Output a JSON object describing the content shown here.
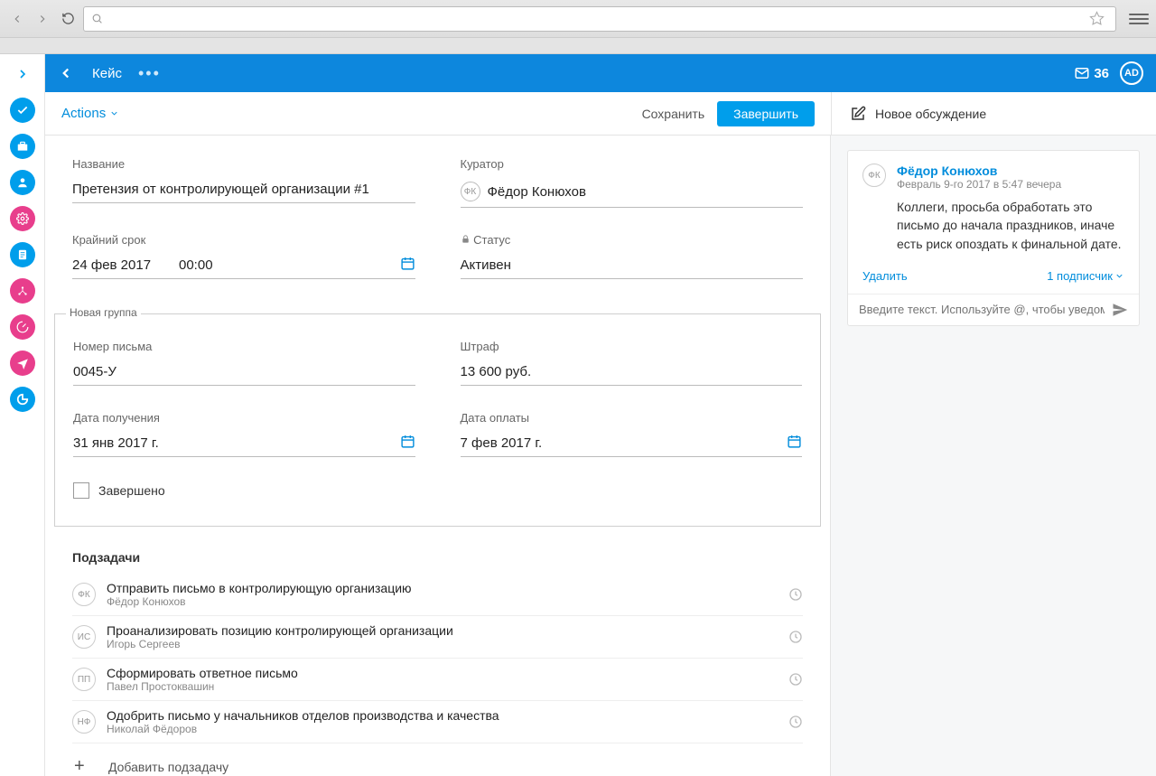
{
  "browser": {
    "search_placeholder": ""
  },
  "topbar": {
    "title": "Кейс",
    "mail_count": "36",
    "avatar_initials": "AD"
  },
  "subbar": {
    "actions_label": "Actions",
    "save_label": "Сохранить",
    "complete_label": "Завершить",
    "new_discussion_label": "Новое обсуждение"
  },
  "fields": {
    "name_label": "Название",
    "name_value": "Претензия от контролирующей организации #1",
    "curator_label": "Куратор",
    "curator_initials": "ФК",
    "curator_name": "Фёдор Конюхов",
    "deadline_label": "Крайний срок",
    "deadline_date": "24 фев 2017",
    "deadline_time": "00:00",
    "status_label": "Статус",
    "status_value": "Активен"
  },
  "group": {
    "legend": "Новая группа",
    "letter_num_label": "Номер письма",
    "letter_num_value": "0045-У",
    "fine_label": "Штраф",
    "fine_value": "13 600 руб.",
    "received_label": "Дата получения",
    "received_value": "31 янв 2017 г.",
    "paid_label": "Дата оплаты",
    "paid_value": "7 фев 2017 г.",
    "completed_label": "Завершено"
  },
  "subtasks": {
    "heading": "Подзадачи",
    "add_label": "Добавить подзадачу",
    "items": [
      {
        "av": "ФК",
        "title": "Отправить письмо в контролирующую организацию",
        "assignee": "Фёдор Конюхов"
      },
      {
        "av": "ИС",
        "title": "Проанализировать позицию контролирующей организации",
        "assignee": "Игорь Сергеев"
      },
      {
        "av": "ПП",
        "title": "Сформировать ответное письмо",
        "assignee": "Павел Простоквашин"
      },
      {
        "av": "НФ",
        "title": "Одобрить письмо у начальников отделов производства и качества",
        "assignee": "Николай Фёдоров"
      }
    ]
  },
  "comment": {
    "av": "ФК",
    "author": "Фёдор Конюхов",
    "meta": "Февраль 9-го 2017 в 5:47 вечера",
    "text": "Коллеги, просьба обработать это письмо до начала праздников, иначе есть риск опоздать к финальной дате.",
    "delete_label": "Удалить",
    "subscribers_label": "1 подписчик",
    "compose_placeholder": "Введите текст. Используйте @, чтобы уведомить"
  }
}
